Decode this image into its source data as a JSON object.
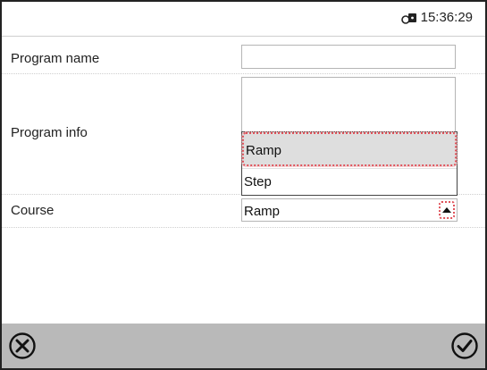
{
  "status_bar": {
    "time": "15:36:29",
    "lock_icon": "lock-key-icon"
  },
  "form": {
    "program_name": {
      "label": "Program name",
      "value": ""
    },
    "program_info": {
      "label": "Program info",
      "value": ""
    },
    "course": {
      "label": "Course",
      "value": "Ramp",
      "options": [
        "Ramp",
        "Step"
      ],
      "highlighted_option": "Ramp"
    }
  },
  "footer": {
    "cancel_icon": "cancel-circle-icon",
    "confirm_icon": "confirm-check-icon"
  }
}
